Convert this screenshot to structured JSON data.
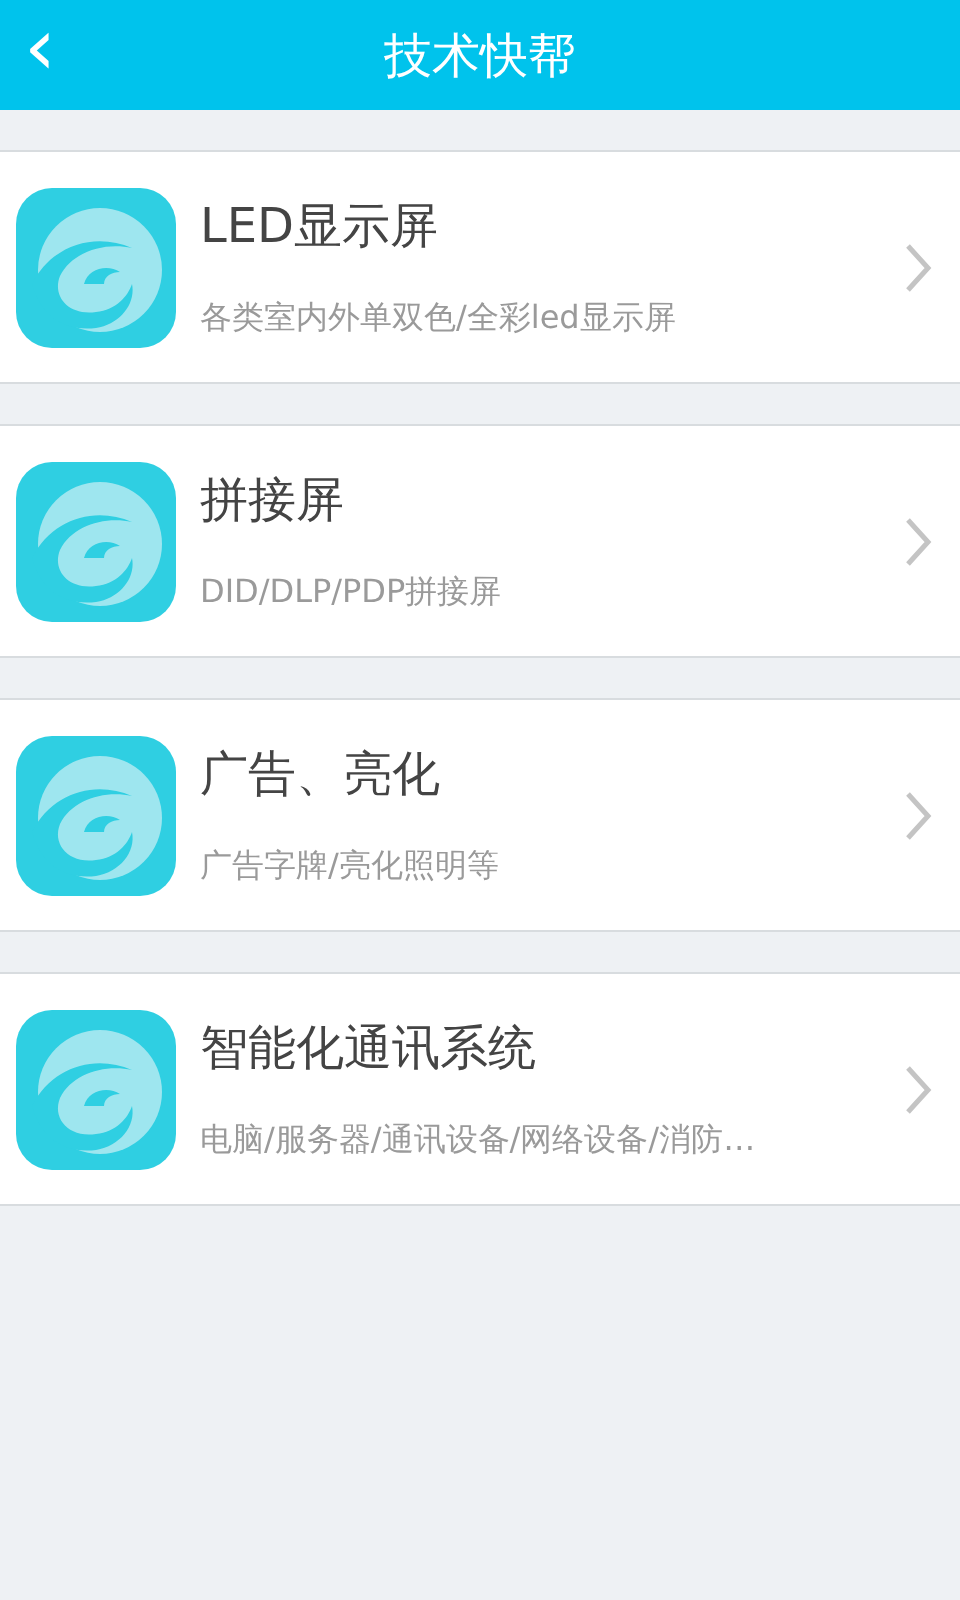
{
  "header": {
    "back": "‹",
    "title": "技术快帮"
  },
  "items": [
    {
      "title": "LED显示屏",
      "subtitle": "各类室内外单双色/全彩led显示屏"
    },
    {
      "title": "拼接屏",
      "subtitle": "DID/DLP/PDP拼接屏"
    },
    {
      "title": "广告、亮化",
      "subtitle": "广告字牌/亮化照明等"
    },
    {
      "title": "智能化通讯系统",
      "subtitle": "电脑/服务器/通讯设备/网络设备/消防…"
    }
  ]
}
